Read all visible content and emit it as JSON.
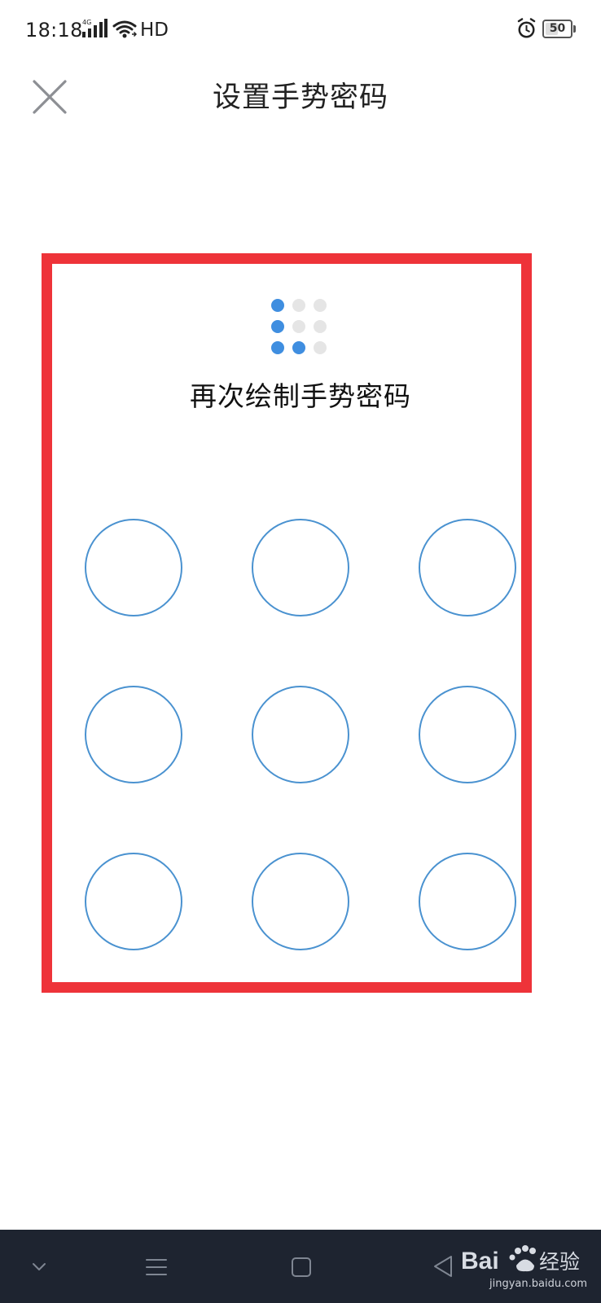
{
  "status_bar": {
    "time": "18:18",
    "network_label": "4G",
    "hd_label": "HD",
    "battery_level": "50",
    "icons": [
      "network-signal-icon",
      "wifi-icon",
      "alarm-icon",
      "battery-icon"
    ]
  },
  "header": {
    "title": "设置手势密码",
    "close_icon": "close-icon"
  },
  "gesture_setup": {
    "instruction": "再次绘制手势密码",
    "preview_active": [
      true,
      false,
      false,
      true,
      false,
      false,
      true,
      true,
      false
    ],
    "grid_rows": 3,
    "grid_cols": 3
  },
  "navigation": {
    "icons": [
      "chevron-down-icon",
      "menu-icon",
      "home-icon",
      "back-icon"
    ]
  },
  "watermark": {
    "brand": "Bai",
    "brand_suffix": "经验",
    "site": "jingyan.baidu.com"
  },
  "colors": {
    "highlight_frame": "#ee3339",
    "accent_blue": "#3f8ee0",
    "node_outline": "#4a92d0",
    "inactive_dot": "#e5e5e5",
    "nav_background": "#1e2430"
  }
}
